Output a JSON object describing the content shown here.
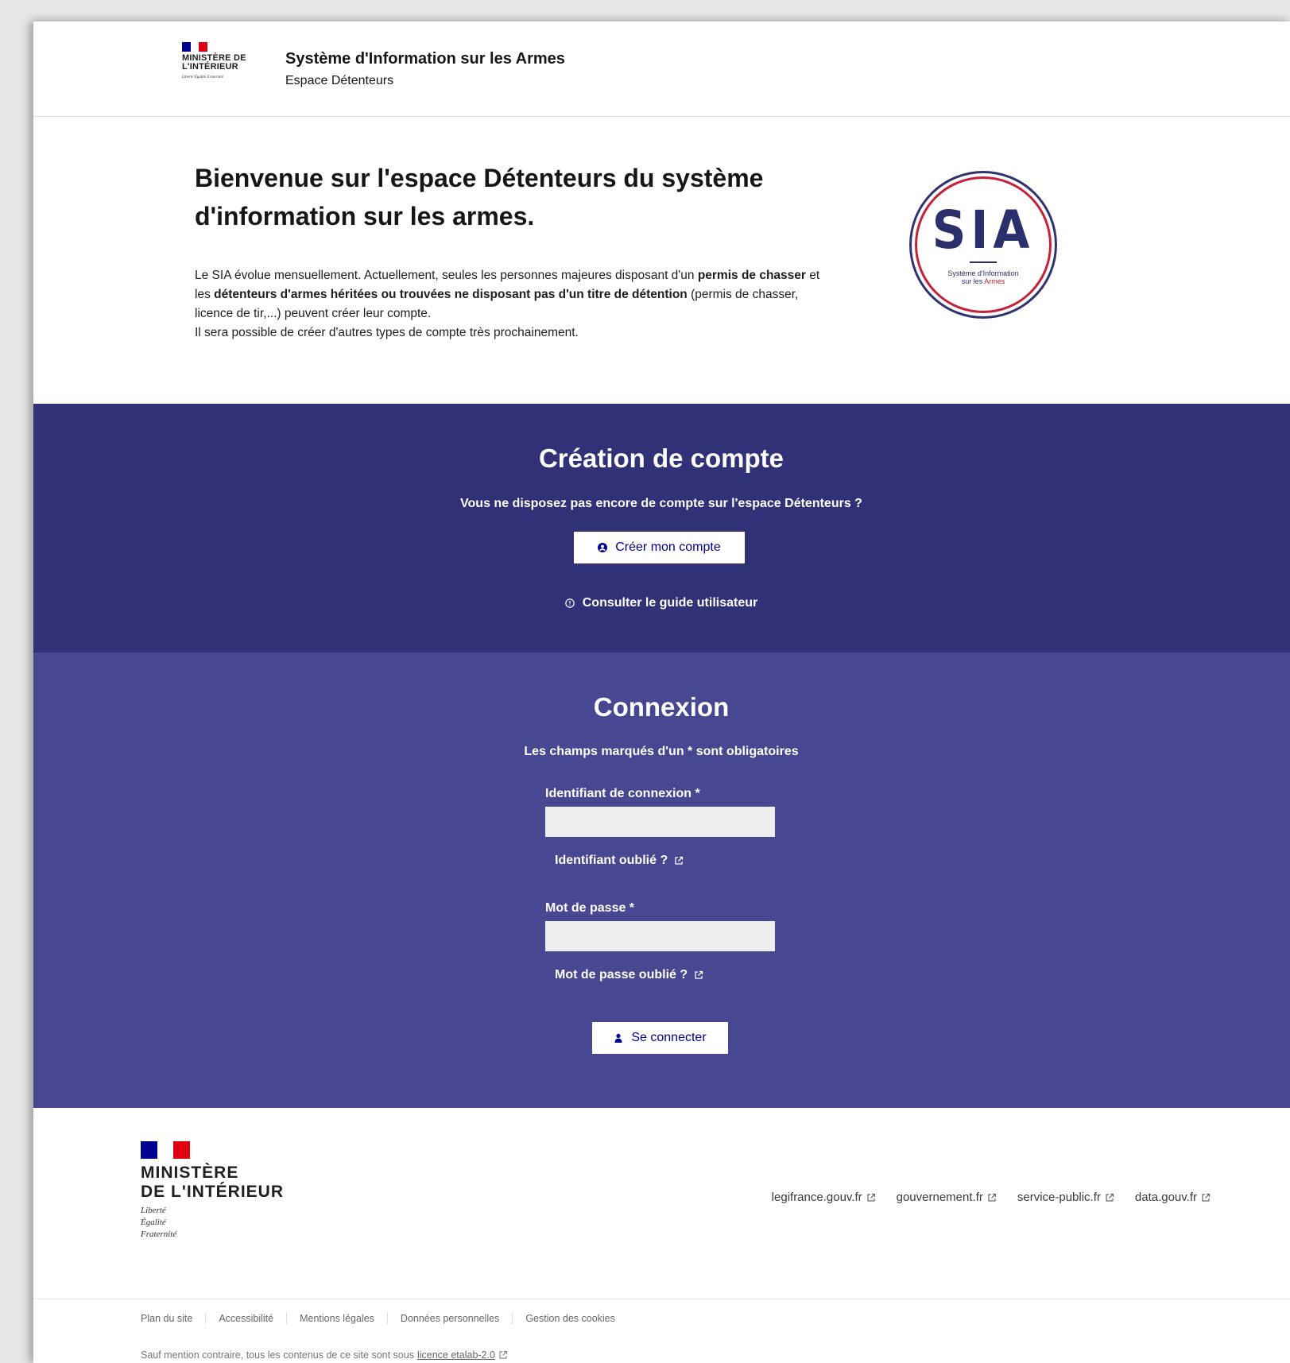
{
  "header": {
    "ministry": "MINISTÈRE DE L'INTÉRIEUR",
    "motto": "Liberté Égalité Fraternité",
    "title": "Système d'Information sur les Armes",
    "subtitle": "Espace Détenteurs"
  },
  "intro": {
    "heading": "Bienvenue sur l'espace Détenteurs du système d'information sur les armes.",
    "p1_a": "Le SIA évolue mensuellement. Actuellement, seules les personnes majeures disposant d'un ",
    "p1_b": "permis de chasser",
    "p1_c": " et les ",
    "p1_d": "détenteurs d'armes héritées ou trouvées ne disposant pas d'un titre de détention",
    "p1_e": " (permis de chasser, licence de tir,...) peuvent créer leur compte.",
    "p2": "Il sera possible de créer d'autres types de compte très prochainement.",
    "badge_big": "SIA",
    "badge_line1": "Système d'Information",
    "badge_line2a": "sur les ",
    "badge_line2b": "Armes"
  },
  "creation": {
    "heading": "Création de compte",
    "question": "Vous ne disposez pas encore de compte sur l'espace Détenteurs ?",
    "button": "Créer mon compte",
    "guide": "Consulter le guide utilisateur"
  },
  "connexion": {
    "heading": "Connexion",
    "required_note": "Les champs marqués d'un * sont obligatoires",
    "login_label": "Identifiant de connexion *",
    "login_value": "",
    "login_forgot": "Identifiant oublié ?",
    "password_label": "Mot de passe *",
    "password_value": "",
    "password_forgot": "Mot de passe oublié ?",
    "button": "Se connecter"
  },
  "footer": {
    "ministry_line1": "MINISTÈRE",
    "ministry_line2": "DE L'INTÉRIEUR",
    "motto1": "Liberté",
    "motto2": "Égalité",
    "motto3": "Fraternité",
    "external_links": [
      "legifrance.gouv.fr",
      "gouvernement.fr",
      "service-public.fr",
      "data.gouv.fr"
    ],
    "bottom_links": [
      "Plan du site",
      "Accessibilité",
      "Mentions légales",
      "Données personnelles",
      "Gestion des cookies"
    ],
    "license_prefix": "Sauf mention contraire, tous les contenus de ce site sont sous ",
    "license_link": "licence etalab-2.0"
  },
  "colors": {
    "creation_bg": "#313178",
    "connexion_bg": "#484792",
    "marianne_blue": "#000091",
    "marianne_red": "#e1000f"
  }
}
